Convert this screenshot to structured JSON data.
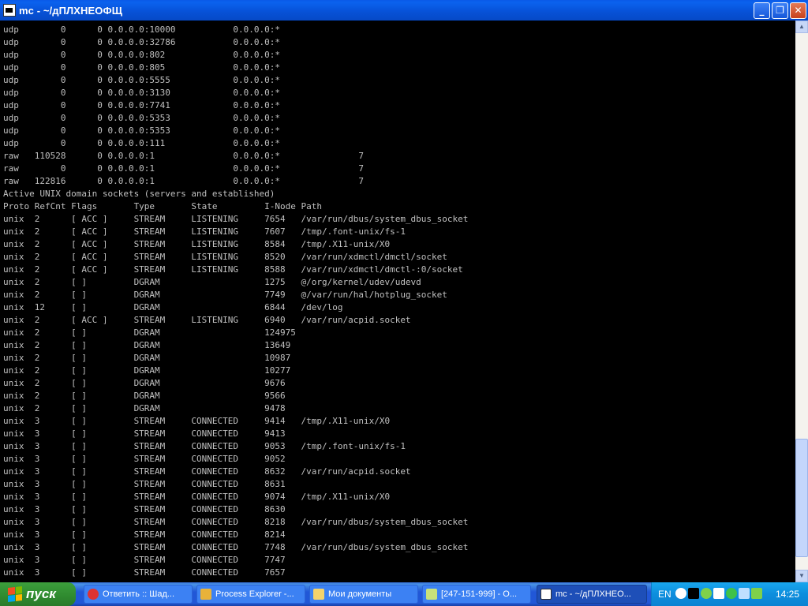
{
  "window": {
    "title": "mc - ~/дПЛХНЕОФЩ"
  },
  "terminal": {
    "lines": [
      "udp        0      0 0.0.0.0:10000           0.0.0.0:*",
      "udp        0      0 0.0.0.0:32786           0.0.0.0:*",
      "udp        0      0 0.0.0.0:802             0.0.0.0:*",
      "udp        0      0 0.0.0.0:805             0.0.0.0:*",
      "udp        0      0 0.0.0.0:5555            0.0.0.0:*",
      "udp        0      0 0.0.0.0:3130            0.0.0.0:*",
      "udp        0      0 0.0.0.0:7741            0.0.0.0:*",
      "udp        0      0 0.0.0.0:5353            0.0.0.0:*",
      "udp        0      0 0.0.0.0:5353            0.0.0.0:*",
      "udp        0      0 0.0.0.0:111             0.0.0.0:*",
      "raw   110528      0 0.0.0.0:1               0.0.0.0:*               7",
      "raw        0      0 0.0.0.0:1               0.0.0.0:*               7",
      "raw   122816      0 0.0.0.0:1               0.0.0.0:*               7",
      "Active UNIX domain sockets (servers and established)",
      "Proto RefCnt Flags       Type       State         I-Node Path",
      "unix  2      [ ACC ]     STREAM     LISTENING     7654   /var/run/dbus/system_dbus_socket",
      "unix  2      [ ACC ]     STREAM     LISTENING     7607   /tmp/.font-unix/fs-1",
      "unix  2      [ ACC ]     STREAM     LISTENING     8584   /tmp/.X11-unix/X0",
      "unix  2      [ ACC ]     STREAM     LISTENING     8520   /var/run/xdmctl/dmctl/socket",
      "unix  2      [ ACC ]     STREAM     LISTENING     8588   /var/run/xdmctl/dmctl-:0/socket",
      "unix  2      [ ]         DGRAM                    1275   @/org/kernel/udev/udevd",
      "unix  2      [ ]         DGRAM                    7749   @/var/run/hal/hotplug_socket",
      "unix  12     [ ]         DGRAM                    6844   /dev/log",
      "unix  2      [ ACC ]     STREAM     LISTENING     6940   /var/run/acpid.socket",
      "unix  2      [ ]         DGRAM                    124975",
      "unix  2      [ ]         DGRAM                    13649",
      "unix  2      [ ]         DGRAM                    10987",
      "unix  2      [ ]         DGRAM                    10277",
      "unix  2      [ ]         DGRAM                    9676",
      "unix  2      [ ]         DGRAM                    9566",
      "unix  2      [ ]         DGRAM                    9478",
      "unix  3      [ ]         STREAM     CONNECTED     9414   /tmp/.X11-unix/X0",
      "unix  3      [ ]         STREAM     CONNECTED     9413",
      "unix  3      [ ]         STREAM     CONNECTED     9053   /tmp/.font-unix/fs-1",
      "unix  3      [ ]         STREAM     CONNECTED     9052",
      "unix  3      [ ]         STREAM     CONNECTED     8632   /var/run/acpid.socket",
      "unix  3      [ ]         STREAM     CONNECTED     8631",
      "unix  3      [ ]         STREAM     CONNECTED     9074   /tmp/.X11-unix/X0",
      "unix  3      [ ]         STREAM     CONNECTED     8630",
      "unix  3      [ ]         STREAM     CONNECTED     8218   /var/run/dbus/system_dbus_socket",
      "unix  3      [ ]         STREAM     CONNECTED     8214",
      "unix  3      [ ]         STREAM     CONNECTED     7748   /var/run/dbus/system_dbus_socket",
      "unix  3      [ ]         STREAM     CONNECTED     7747",
      "unix  3      [ ]         STREAM     CONNECTED     7657"
    ]
  },
  "taskbar": {
    "start_label": "пуск",
    "tasks": [
      {
        "label": "Ответить :: Шад...",
        "icon": "opera-icon",
        "color": "#d33"
      },
      {
        "label": "Process Explorer -...",
        "icon": "process-explorer-icon",
        "color": "#e8b23a"
      },
      {
        "label": "Мои документы",
        "icon": "folder-icon",
        "color": "#f5d36b"
      },
      {
        "label": "[247-151-999] - О...",
        "icon": "chat-icon",
        "color": "#c9e27a"
      },
      {
        "label": "mc - ~/дПЛХНЕО...",
        "icon": "terminal-icon",
        "color": "#ffffff"
      }
    ],
    "tray": {
      "lang": "EN",
      "clock": "14:25",
      "icons": [
        {
          "name": "chevron-left-icon",
          "color": "#ffffff"
        },
        {
          "name": "terminal-tray-icon",
          "color": "#000000"
        },
        {
          "name": "flower-icon",
          "color": "#7fd14a"
        },
        {
          "name": "mail-icon",
          "color": "#ffffff"
        },
        {
          "name": "at-sign-icon",
          "color": "#3fc24a"
        },
        {
          "name": "network-icon",
          "color": "#bfe0ff"
        },
        {
          "name": "messenger-icon",
          "color": "#7fd14a"
        }
      ]
    }
  }
}
